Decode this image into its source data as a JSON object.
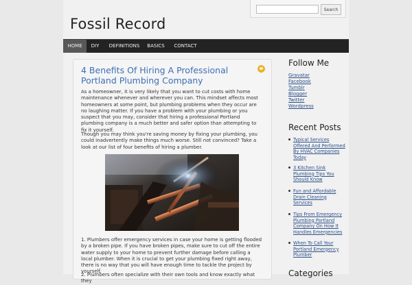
{
  "header": {
    "site_title": "Fossil Record",
    "search": {
      "placeholder": "",
      "button_label": "Search"
    }
  },
  "nav": {
    "items": [
      {
        "label": "HOME",
        "active": true
      },
      {
        "label": "DIY",
        "active": false
      },
      {
        "label": "DEFINITIONS",
        "active": false
      },
      {
        "label": "BASICS",
        "active": false
      },
      {
        "label": "CONTACT",
        "active": false
      }
    ]
  },
  "article": {
    "title": "4 Benefits Of Hiring A Professional Portland Plumbing Company",
    "paragraphs": [
      "As a homeowner, it is very likely that you want to cut costs with home maintenance whenever and wherever you can. This mindset affects most homeowners at some point, but plumbing problems when they occur are no laughing matter. If you have a problem with your plumbing or you suspect that you may, consider that hiring a professional Portland plumbing company is a much better and safer option than attempting to fix it yourself.",
      "Though you may think you're saving money by fixing your plumbing, you could inadvertently make things much worse. Still not convinced? Take a look at our list of four benefits of hiring a plumber.",
      "1. Plumbers offer emergency services in case your home is getting flooded by a broken pipe. If you have broken pipes, make sure to cut off the entire water supply to your home to prevent further damage before calling a local plumber. When it is crucial to get your plumbing fixed right away, there is no way that you will have enough time to tackle the project by yourself.",
      "2. Plumbers often specialize with their own tools and know exactly what they"
    ],
    "comment_icon": "comment-bubble-icon"
  },
  "sidebar": {
    "follow": {
      "title": "Follow Me",
      "links": [
        "Gravatar",
        "Facebook",
        "Tumblr",
        "Blogger",
        "Twitter",
        "Wordpress"
      ]
    },
    "recent": {
      "title": "Recent Posts",
      "posts": [
        "Typical Services Offered And Performed By HVAC Companies Today",
        "3 Kitchen Sink Plumbing Tips You Should Know",
        "Fun and Affordable Drain Cleaning Services",
        "Tips From Emergency Plumbing Portland Company On How It Handles Emergencies",
        "When To Call Your Portland Emergency Plumber"
      ]
    },
    "next_title_partial": "Categories"
  },
  "colors": {
    "nav_bg": "#232323",
    "nav_active": "#585858",
    "link": "#2a4f8a",
    "title_link": "#3c6fb5",
    "accent_icon": "#f0b323"
  }
}
